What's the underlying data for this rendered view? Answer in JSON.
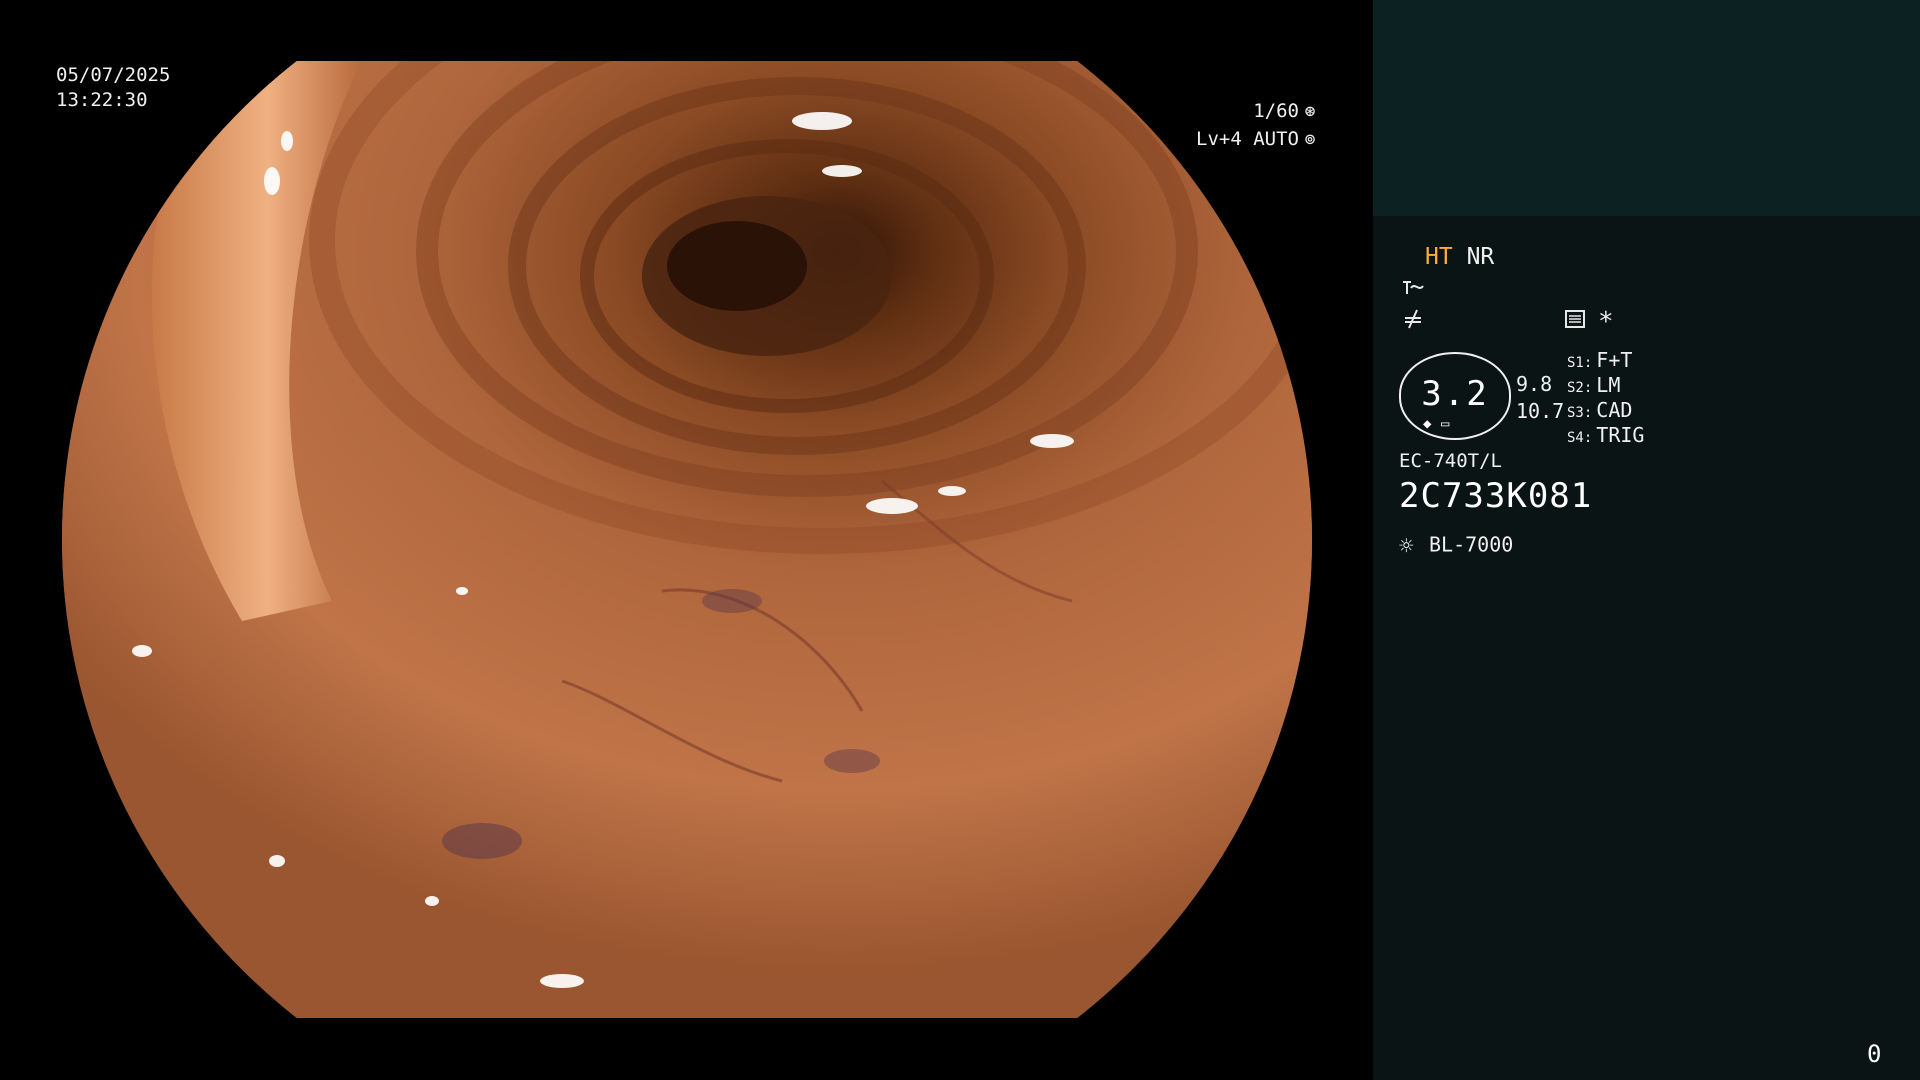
{
  "osd": {
    "date": "05/07/2025",
    "time": "13:22:30",
    "shutter": "1/60",
    "shutter_icon": "shutter-aperture-icon",
    "iris": "Lv+4 AUTO",
    "iris_icon": "auto-iris-icon"
  },
  "panel": {
    "mode_ht": "HT",
    "mode_nr": "NR",
    "icons": [
      "enhancement-curve-icon",
      "structure-enhancement-icon",
      "record-icon",
      "asterisk-icon"
    ],
    "asterisk": "*",
    "zoom": "3.2",
    "readout_1": "9.8",
    "readout_2": "10.7",
    "switches": [
      {
        "key": "S1:",
        "value": "F+T"
      },
      {
        "key": "S2:",
        "value": "LM"
      },
      {
        "key": "S3:",
        "value": "CAD"
      },
      {
        "key": "S4:",
        "value": "TRIG"
      }
    ],
    "scope_model": "EC-740T/L",
    "serial": "2C733K081",
    "light_source": "BL-7000",
    "light_icon": "sun-light-icon",
    "corner_number": "0"
  },
  "colors": {
    "ht_accent": "#ffab3a",
    "panel_top": "#0c2222",
    "panel_bottom": "#0a1414",
    "mucosa": "#a8603a"
  }
}
